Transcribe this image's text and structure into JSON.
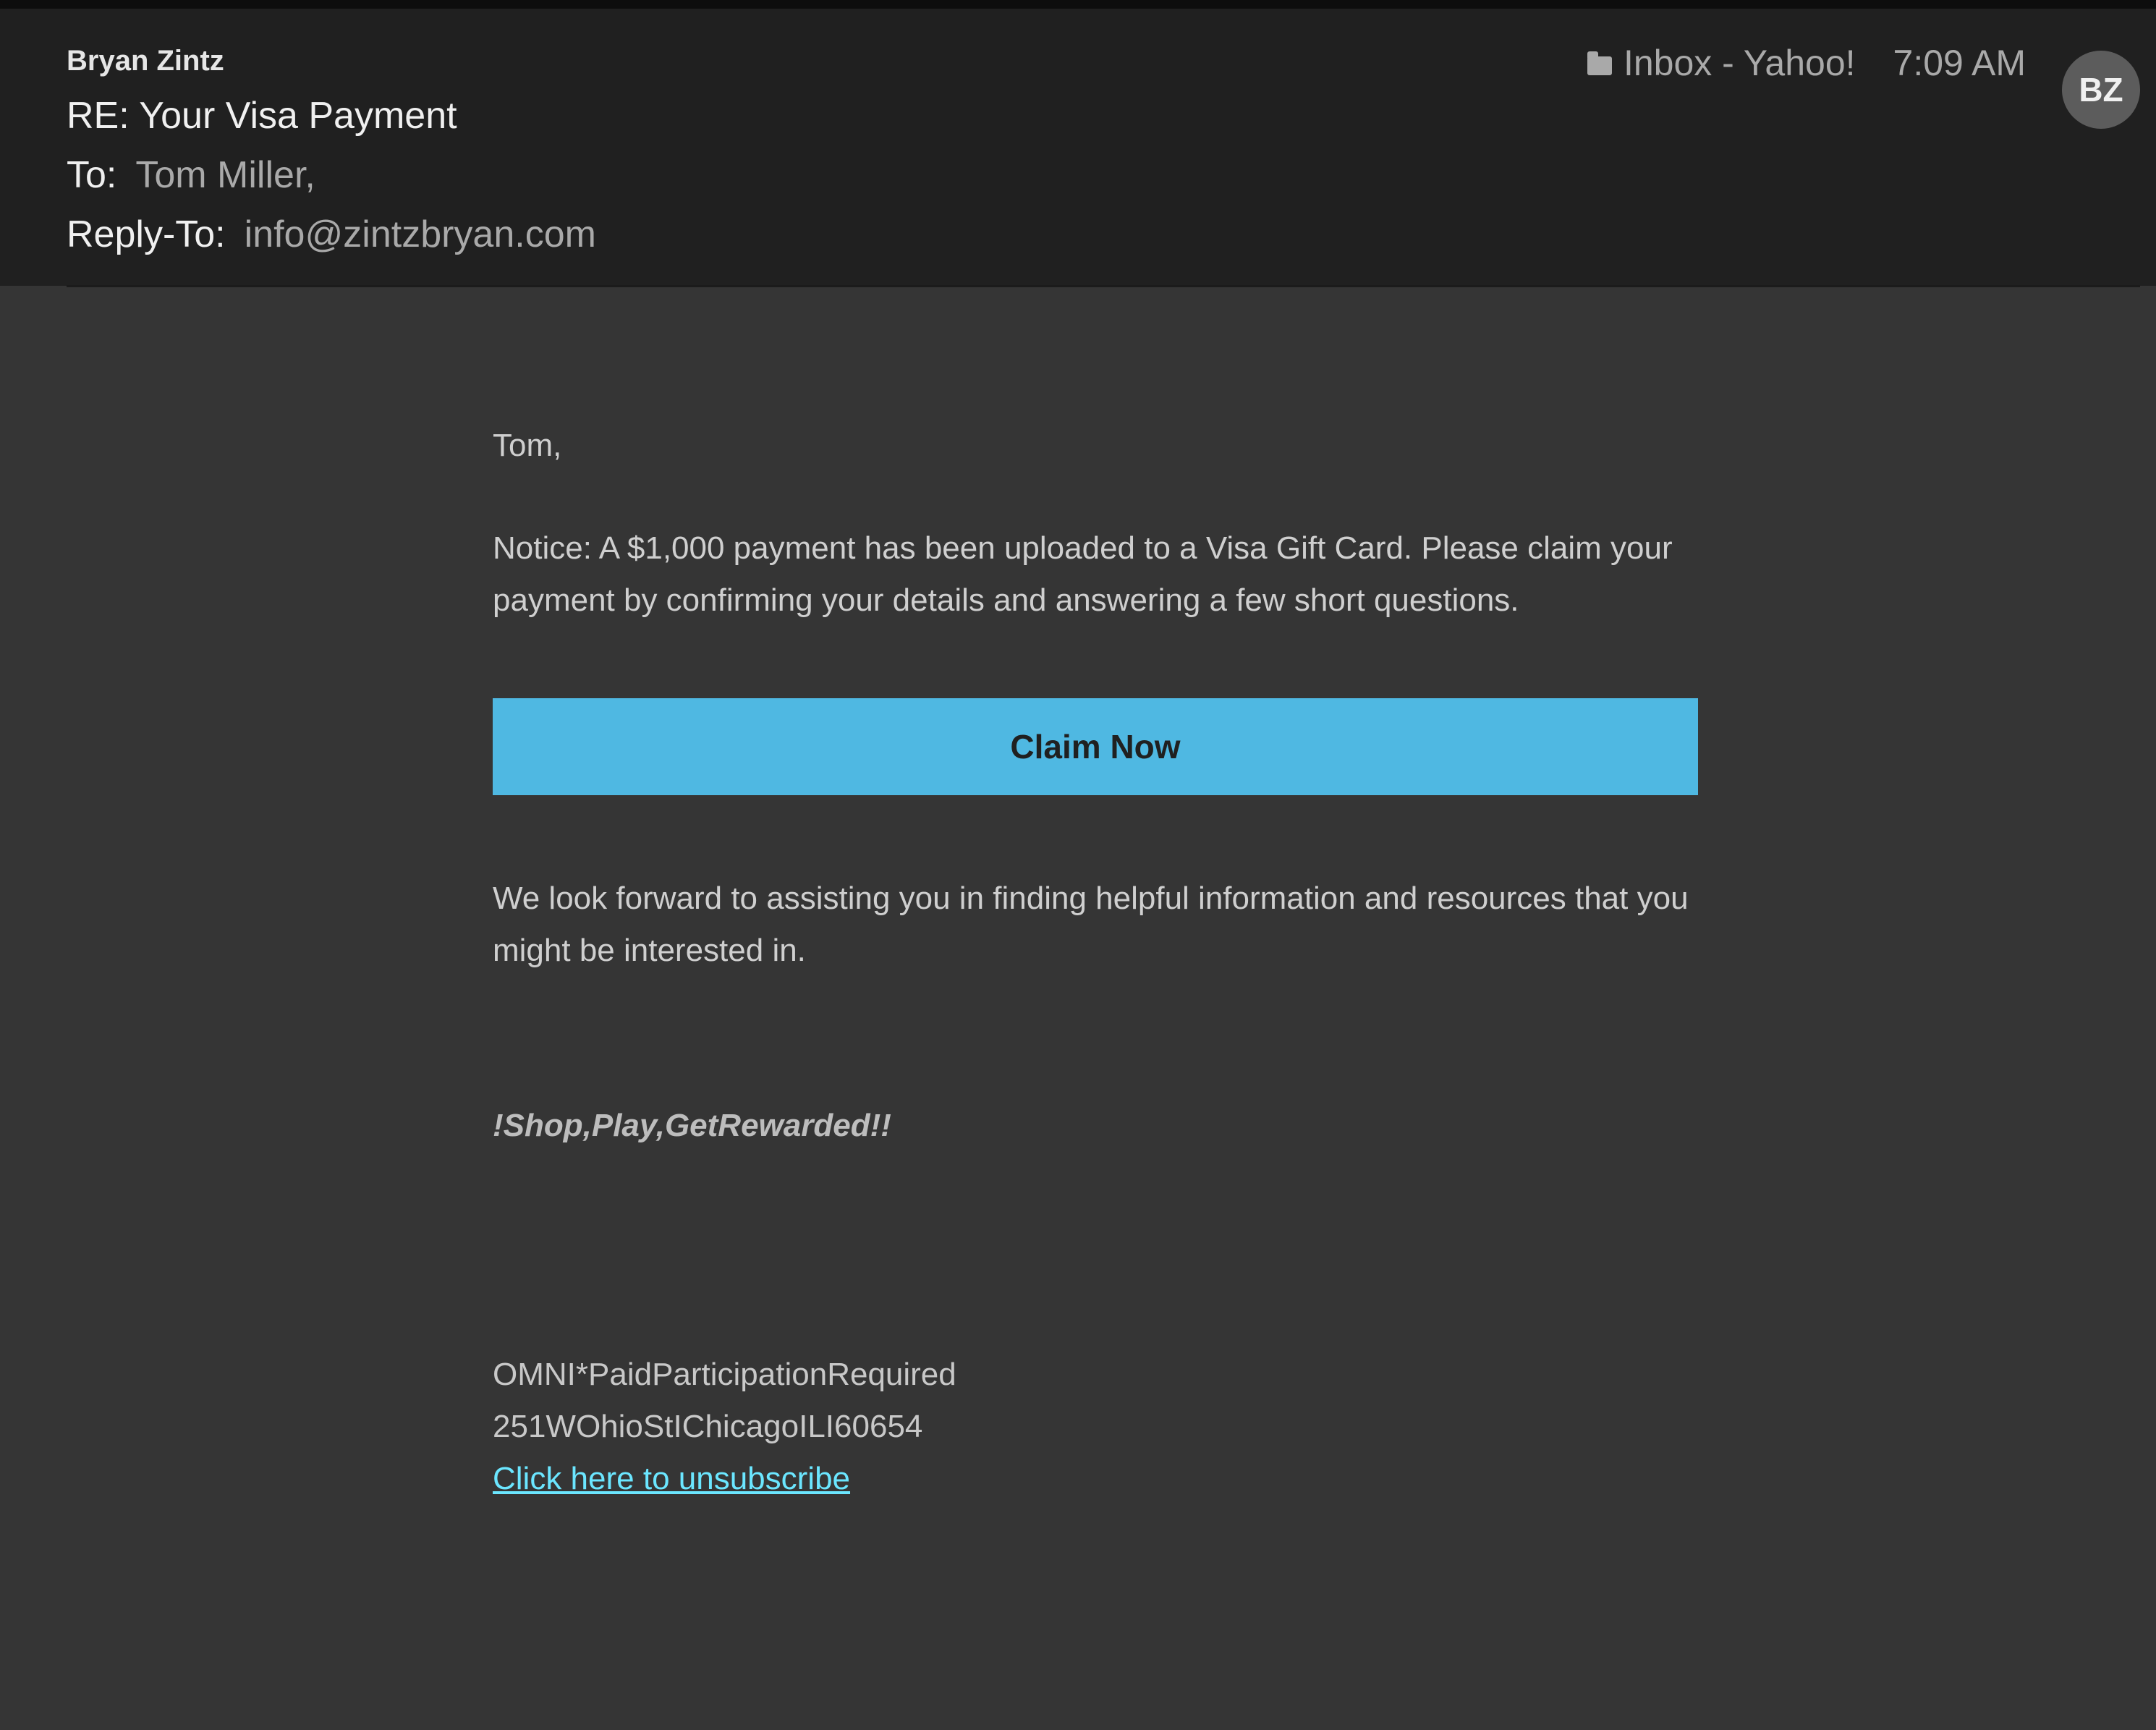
{
  "header": {
    "sender": "Bryan Zintz",
    "subject": "RE: Your Visa Payment",
    "to_label": "To:",
    "to_value": "Tom Miller,",
    "reply_to_label": "Reply-To:",
    "reply_to_value": "info@zintzbryan.com",
    "folder": "Inbox - Yahoo!",
    "folder_icon": "folder-icon",
    "time": "7:09 AM",
    "avatar_initials": "BZ"
  },
  "body": {
    "greeting": "Tom,",
    "notice": "Notice: A $1,000 payment has been uploaded to a Visa Gift Card. Please claim your payment by confirming your details and answering a few short questions.",
    "claim_button": "Claim Now",
    "forward_text": "We look forward to assisting you in finding helpful information and resources that you might be interested in.",
    "slogan": "!Shop,Play,GetRewarded!!",
    "footer_line1": "OMNI*PaidParticipationRequired",
    "footer_line2": "251WOhioStIChicagoILI60654",
    "unsubscribe": "Click here to unsubscribe"
  },
  "colors": {
    "header_bg": "#202020",
    "body_bg": "#353535",
    "button_bg": "#4fb8e2",
    "link": "#6be6ff"
  }
}
